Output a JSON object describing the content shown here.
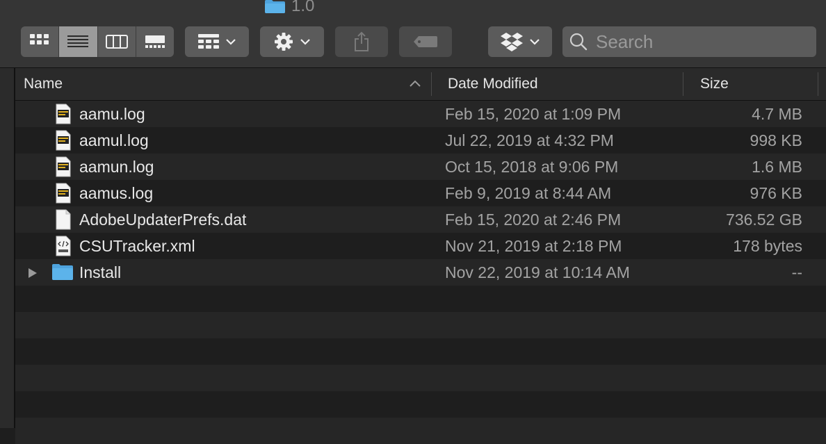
{
  "window": {
    "title": "1.0"
  },
  "toolbar": {
    "view_modes": [
      "icon-view",
      "list-view",
      "column-view",
      "gallery-view"
    ],
    "active_view": "list-view",
    "search_placeholder": "Search"
  },
  "columns": {
    "name": "Name",
    "date_modified": "Date Modified",
    "size": "Size"
  },
  "files": [
    {
      "name": "aamu.log",
      "date": "Feb 15, 2020 at 1:09 PM",
      "size": "4.7 MB",
      "icon": "log-file-icon"
    },
    {
      "name": "aamul.log",
      "date": "Jul 22, 2019 at 4:32 PM",
      "size": "998 KB",
      "icon": "log-file-icon"
    },
    {
      "name": "aamun.log",
      "date": "Oct 15, 2018 at 9:06 PM",
      "size": "1.6 MB",
      "icon": "log-file-icon"
    },
    {
      "name": "aamus.log",
      "date": "Feb 9, 2019 at 8:44 AM",
      "size": "976 KB",
      "icon": "log-file-icon"
    },
    {
      "name": "AdobeUpdaterPrefs.dat",
      "date": "Feb 15, 2020 at 2:46 PM",
      "size": "736.52 GB",
      "icon": "blank-document-icon"
    },
    {
      "name": "CSUTracker.xml",
      "date": "Nov 21, 2019 at 2:18 PM",
      "size": "178 bytes",
      "icon": "xml-file-icon"
    },
    {
      "name": "Install",
      "date": "Nov 22, 2019 at 10:14 AM",
      "size": "--",
      "icon": "folder-icon"
    }
  ],
  "colors": {
    "toolbar_bg": "#353535",
    "button_bg": "#5b5b5b",
    "row_odd": "#262626",
    "row_even": "#1e1e1e",
    "folder_blue": "#4ea3dd"
  }
}
